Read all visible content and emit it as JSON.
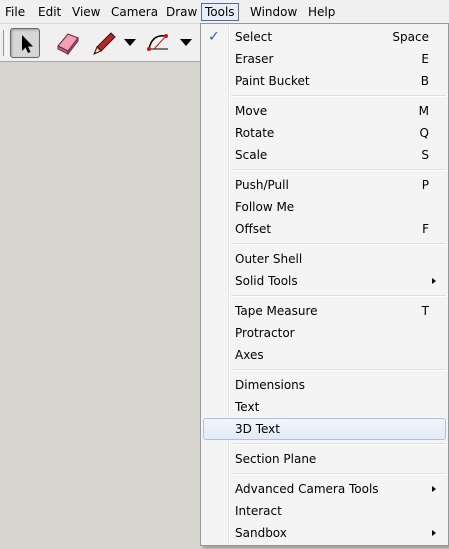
{
  "menubar": {
    "items": [
      "File",
      "Edit",
      "View",
      "Camera",
      "Draw",
      "Tools",
      "Window",
      "Help"
    ],
    "active": "Tools"
  },
  "toolbar": {
    "tools": [
      "select-tool",
      "eraser-tool",
      "pencil-tool",
      "arc-tool"
    ]
  },
  "tools_menu": {
    "groups": [
      [
        {
          "label": "Select",
          "shortcut": "Space",
          "checked": true
        },
        {
          "label": "Eraser",
          "shortcut": "E"
        },
        {
          "label": "Paint Bucket",
          "shortcut": "B"
        }
      ],
      [
        {
          "label": "Move",
          "shortcut": "M"
        },
        {
          "label": "Rotate",
          "shortcut": "Q"
        },
        {
          "label": "Scale",
          "shortcut": "S"
        }
      ],
      [
        {
          "label": "Push/Pull",
          "shortcut": "P"
        },
        {
          "label": "Follow Me",
          "shortcut": ""
        },
        {
          "label": "Offset",
          "shortcut": "F"
        }
      ],
      [
        {
          "label": "Outer Shell",
          "shortcut": ""
        },
        {
          "label": "Solid Tools",
          "shortcut": "",
          "submenu": true
        }
      ],
      [
        {
          "label": "Tape Measure",
          "shortcut": "T"
        },
        {
          "label": "Protractor",
          "shortcut": ""
        },
        {
          "label": "Axes",
          "shortcut": ""
        }
      ],
      [
        {
          "label": "Dimensions",
          "shortcut": ""
        },
        {
          "label": "Text",
          "shortcut": ""
        },
        {
          "label": "3D Text",
          "shortcut": "",
          "hover": true
        }
      ],
      [
        {
          "label": "Section Plane",
          "shortcut": ""
        }
      ],
      [
        {
          "label": "Advanced Camera Tools",
          "shortcut": "",
          "submenu": true
        },
        {
          "label": "Interact",
          "shortcut": ""
        },
        {
          "label": "Sandbox",
          "shortcut": "",
          "submenu": true
        }
      ]
    ]
  },
  "colors": {
    "canvas": "#d7d5cf",
    "check": "#2a5db0",
    "hover_border": "#a8c3e4"
  }
}
